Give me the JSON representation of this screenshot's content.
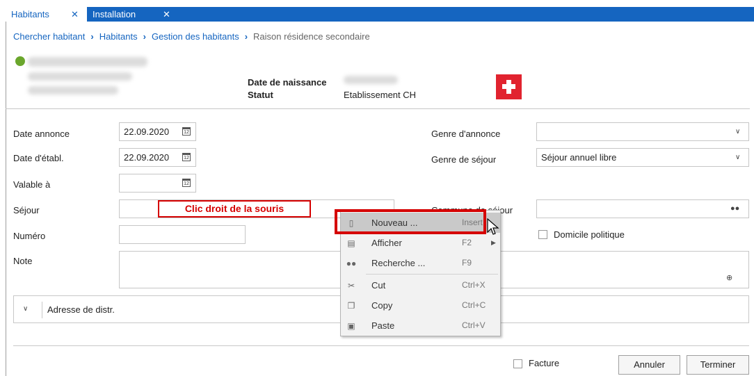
{
  "tabs": [
    {
      "label": "Habitants",
      "close": "✕"
    },
    {
      "label": "Installation",
      "close": "✕"
    }
  ],
  "breadcrumb": {
    "items": [
      "Chercher habitant",
      "Habitants",
      "Gestion des habitants"
    ],
    "current": "Raison résidence secondaire",
    "separator": "›"
  },
  "person": {
    "birthdate_label": "Date de naissance",
    "status_label": "Statut",
    "status_value": "Etablissement CH",
    "status_color": "#6aa62c",
    "flag_color": "#e1232f"
  },
  "form": {
    "date_annonce": {
      "label": "Date annonce",
      "value": "22.09.2020"
    },
    "date_etabl": {
      "label": "Date d'établ.",
      "value": "22.09.2020"
    },
    "valable": {
      "label": "Valable à",
      "value": ""
    },
    "sejour": {
      "label": "Séjour",
      "value": ""
    },
    "numero": {
      "label": "Numéro",
      "value": ""
    },
    "note": {
      "label": "Note",
      "value": ""
    },
    "genre_annonce": {
      "label": "Genre d'annonce",
      "value": ""
    },
    "genre_sejour": {
      "label": "Genre de séjour",
      "value": "Séjour annuel libre"
    },
    "commune_sejour": {
      "label": "Commune de séjour",
      "value": ""
    },
    "domicile_politique": {
      "label": "Domicile politique",
      "checked": false
    },
    "calendar_glyph": "12"
  },
  "section": {
    "label": "Adresse de distr."
  },
  "footer": {
    "facture_label": "Facture",
    "annuler_label": "Annuler",
    "terminer_label": "Terminer"
  },
  "annotation": {
    "text": "Clic droit de la souris",
    "color": "#d50000"
  },
  "context_menu": {
    "items": [
      {
        "label": "Nouveau ...",
        "shortcut": "Insert",
        "icon": "new-document-icon",
        "highlighted": true
      },
      {
        "label": "Afficher",
        "shortcut": "F2",
        "icon": "view-document-icon",
        "submenu": true
      },
      {
        "label": "Recherche ...",
        "shortcut": "F9",
        "icon": "binoculars-icon"
      },
      {
        "label": "Cut",
        "shortcut": "Ctrl+X",
        "icon": "scissors-icon"
      },
      {
        "label": "Copy",
        "shortcut": "Ctrl+C",
        "icon": "copy-icon"
      },
      {
        "label": "Paste",
        "shortcut": "Ctrl+V",
        "icon": "paste-icon"
      }
    ]
  },
  "accent_color": "#1565c0"
}
